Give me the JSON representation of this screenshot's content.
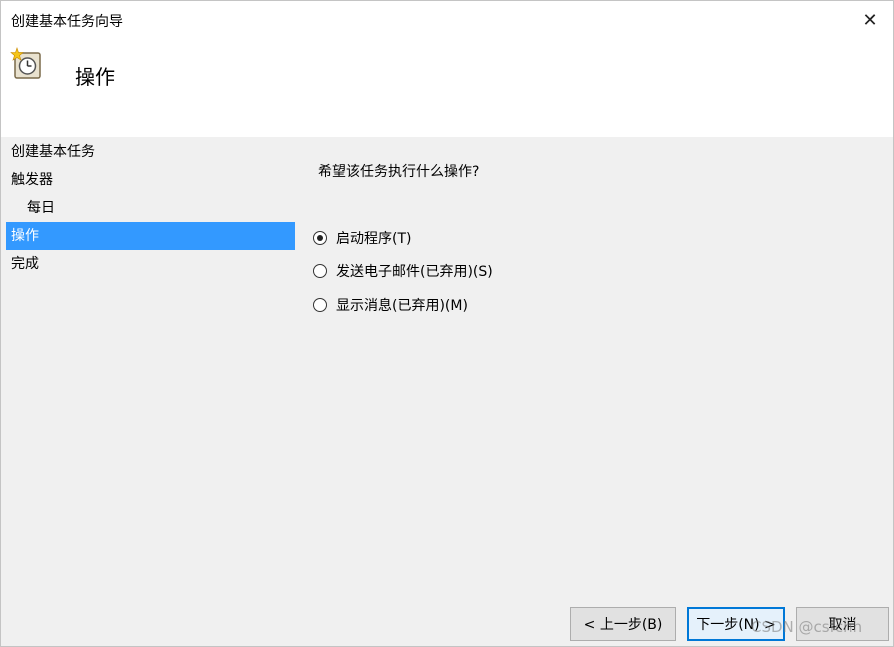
{
  "window": {
    "title": "创建基本任务向导",
    "close_glyph": "✕"
  },
  "header": {
    "title": "操作",
    "icon": "task-scheduler-clock-icon"
  },
  "sidebar": {
    "items": [
      {
        "label": "创建基本任务"
      },
      {
        "label": "触发器"
      },
      {
        "label": "每日"
      },
      {
        "label": "操作"
      },
      {
        "label": "完成"
      }
    ],
    "active_index": 3
  },
  "main": {
    "prompt": "希望该任务执行什么操作?",
    "options": [
      {
        "label": "启动程序(T)",
        "checked": true
      },
      {
        "label": "发送电子邮件(已弃用)(S)",
        "checked": false
      },
      {
        "label": "显示消息(已弃用)(M)",
        "checked": false
      }
    ]
  },
  "footer": {
    "back_label": "< 上一步(B)",
    "next_label": "下一步(N) >",
    "cancel_label": "取消"
  },
  "watermark": "CSDN @csfchh",
  "colors": {
    "selection": "#3399ff",
    "default_button_border": "#0078d7"
  }
}
